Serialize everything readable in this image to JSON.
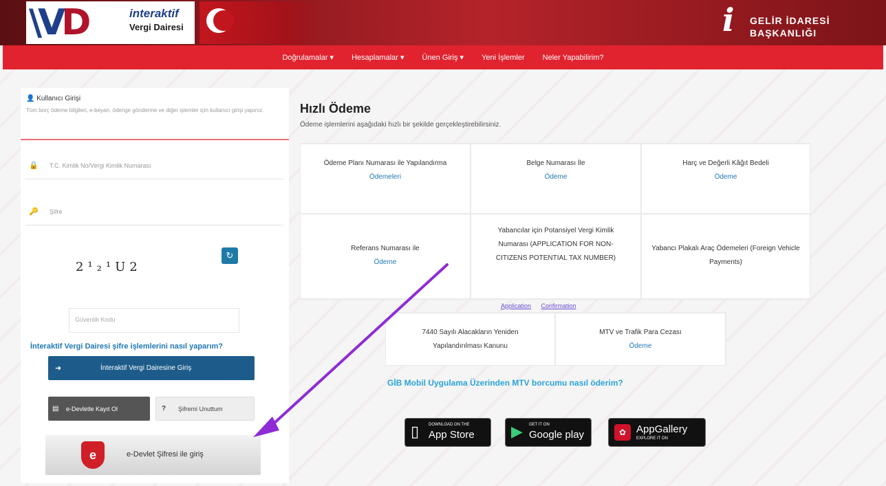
{
  "header": {
    "logo_line1": "interaktif",
    "logo_line2": "Vergi Dairesi",
    "gib_line1": "GELİR İDARESİ",
    "gib_line2": "BAŞKANLIĞI"
  },
  "nav": {
    "items": [
      {
        "label": "Doğrulamalar ▾"
      },
      {
        "label": "Hesaplamalar ▾"
      },
      {
        "label": "Ünen Giriş ▾"
      },
      {
        "label": "Yeni İşlemler"
      },
      {
        "label": "Neler Yapabilirim?"
      }
    ]
  },
  "login": {
    "title": "Kullanıcı Girişi",
    "description": "Tüm borç ödeme bilgileri, e-beyan, ödenge gönderme ve diğer işlemler için kullanıcı girişi yapınız.",
    "user_placeholder": "T.C. Kimlik No/Vergi Kimlik Numarası",
    "password_placeholder": "Şifre",
    "captcha_text": "2¹₂¹U2",
    "security_placeholder": "Güvenlik Kodu",
    "help_link": "İnteraktif Vergi Dairesi şifre işlemlerini nasıl yaparım?",
    "login_button": "İnteraktif Vergi Dairesine Giriş",
    "edevlet_register_button": "e-Devletle Kayıt Ol",
    "forgot_button": "Şifremi Unuttum",
    "edevlet_login_button": "e-Devlet Şifresi ile giriş"
  },
  "quick_pay": {
    "title": "Hızlı Ödeme",
    "subtitle": "Ödeme işlemlerini aşağıdaki hızlı bir şekilde gerçekleştirebilirsiniz.",
    "cells": [
      {
        "text": "Ödeme Planı Numarası ile Yapılandırma",
        "link": "Ödemeleri"
      },
      {
        "text": "Belge Numarası İle",
        "link": "Ödeme"
      },
      {
        "text": "Harç ve Değerli Kâğıt Bedeli",
        "link": "Ödeme"
      },
      {
        "text": "Referans Numarası ile",
        "link": "Ödeme"
      },
      {
        "text": "Yabancılar için Potansiyel Vergi Kimlik Numarası (APPLICATION FOR NON-CITIZENS POTENTIAL TAX NUMBER)",
        "link": ""
      },
      {
        "text": "Yabancı Plakalı Araç Ödemeleri (Foreign Vehicle Payments)",
        "link": ""
      }
    ],
    "app_links": [
      "Application",
      "Confirmation"
    ],
    "cells2": [
      {
        "text": "7440 Sayılı Alacakların Yeniden Yapılandırılması Kanunu",
        "link": ""
      },
      {
        "text": "MTV ve Trafik Para Cezası",
        "link": "Ödeme"
      }
    ],
    "mobile_link": "GİB Mobil Uygulama Üzerinden MTV borcumu nasıl öderim?",
    "stores": [
      {
        "small": "Download on the",
        "big": "App Store",
        "icon": "apple-icon"
      },
      {
        "small": "GET IT ON",
        "big": "Google play",
        "icon": "play-icon"
      },
      {
        "small": "EXPLORE IT ON",
        "big": "AppGallery",
        "icon": "huawei-icon"
      }
    ]
  },
  "colors": {
    "nav_red": "#e0232f",
    "arrow_purple": "#8e2bd6",
    "link_blue": "#1f78b4"
  }
}
